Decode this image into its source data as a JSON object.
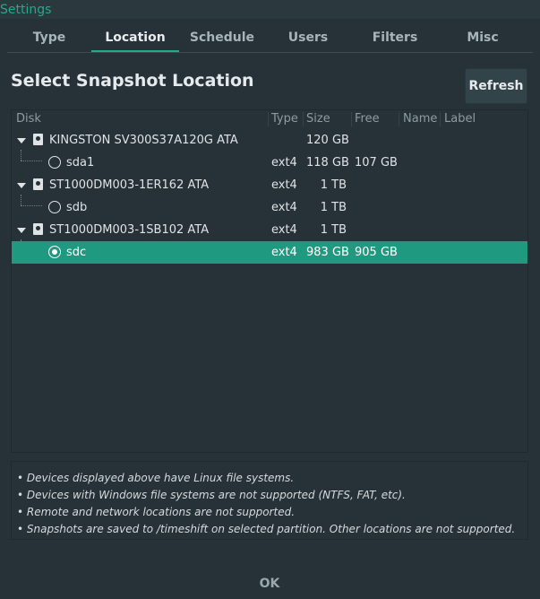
{
  "window": {
    "title": "Settings"
  },
  "tabs": [
    {
      "label": "Type"
    },
    {
      "label": "Location"
    },
    {
      "label": "Schedule"
    },
    {
      "label": "Users"
    },
    {
      "label": "Filters"
    },
    {
      "label": "Misc"
    }
  ],
  "active_tab": "Location",
  "heading": "Select Snapshot Location",
  "refresh_label": "Refresh",
  "columns": [
    "Disk",
    "Type",
    "Size",
    "Free",
    "Name",
    "Label"
  ],
  "rows": [
    {
      "level": "disk",
      "disk": "KINGSTON SV300S37A120G ATA",
      "type": "",
      "size": "120 GB",
      "free": "",
      "selected": false
    },
    {
      "level": "partition",
      "disk": "sda1",
      "type": "ext4",
      "size": "118 GB",
      "free": "107 GB",
      "selected": false
    },
    {
      "level": "disk",
      "disk": "ST1000DM003-1ER162 ATA",
      "type": "ext4",
      "size": "1 TB",
      "free": "",
      "selected": false
    },
    {
      "level": "partition",
      "disk": "sdb",
      "type": "ext4",
      "size": "1 TB",
      "free": "",
      "selected": false
    },
    {
      "level": "disk",
      "disk": "ST1000DM003-1SB102 ATA",
      "type": "ext4",
      "size": "1 TB",
      "free": "",
      "selected": false
    },
    {
      "level": "partition",
      "disk": "sdc",
      "type": "ext4",
      "size": "983 GB",
      "free": "905 GB",
      "selected": true
    }
  ],
  "notes": [
    "• Devices displayed above have Linux file systems.",
    "• Devices with Windows file systems are not supported (NTFS, FAT, etc).",
    "• Remote and network locations are not supported.",
    "• Snapshots are saved to /timeshift on selected partition. Other locations are not supported."
  ],
  "ok_label": "OK",
  "icons": {
    "expander": "triangle-down-icon",
    "disk": "harddisk-icon",
    "partition": "radio-icon"
  },
  "colors": {
    "background": "#263238",
    "accent": "#26a98b",
    "selection": "#1f9a80"
  }
}
